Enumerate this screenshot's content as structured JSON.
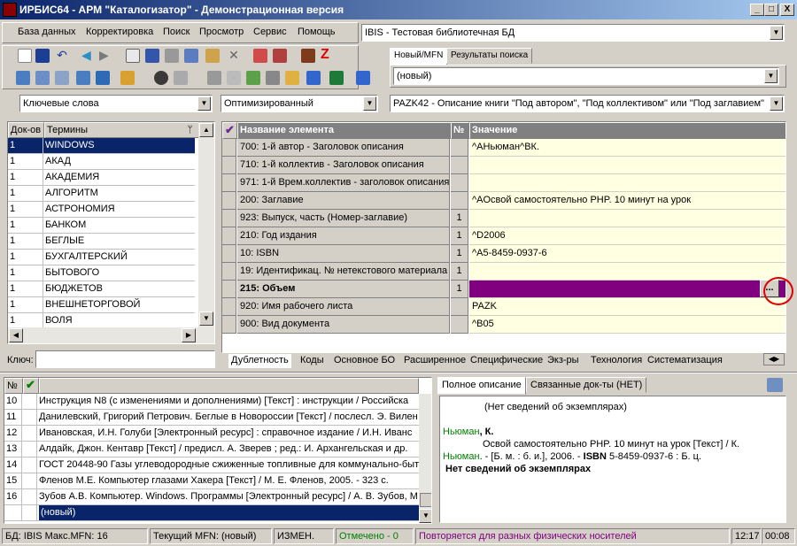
{
  "window": {
    "title": "ИРБИС64 - АРМ \"Каталогизатор\" - Демонстрационная версия",
    "min": "_",
    "max": "□",
    "close": "X"
  },
  "menu": [
    "База данных",
    "Корректировка",
    "Поиск",
    "Просмотр",
    "Сервис",
    "Помощь"
  ],
  "database_combo": "IBIS - Тестовая библиотечная БД",
  "top_tabs": [
    "Новый/MFN",
    "Результаты поиска"
  ],
  "mfn_combo": "(новый)",
  "search_combo": "Ключевые слова",
  "mode_combo": "Оптимизированный",
  "worksheet_combo": "PAZK42 - Описание книги \"Под автором\", \"Под коллективом\" или \"Под заглавием\"",
  "terms": {
    "col_docs": "Док-ов",
    "col_terms": "Термины",
    "rows": [
      {
        "n": "1",
        "t": "WINDOWS"
      },
      {
        "n": "1",
        "t": "АКАД"
      },
      {
        "n": "1",
        "t": "АКАДЕМИЯ"
      },
      {
        "n": "1",
        "t": "АЛГОРИТМ"
      },
      {
        "n": "1",
        "t": "АСТРОНОМИЯ"
      },
      {
        "n": "1",
        "t": "БАНКОМ"
      },
      {
        "n": "1",
        "t": "БЕГЛЫЕ"
      },
      {
        "n": "1",
        "t": "БУХГАЛТЕРСКИЙ"
      },
      {
        "n": "1",
        "t": "БЫТОВОГО"
      },
      {
        "n": "1",
        "t": "БЮДЖЕТОВ"
      },
      {
        "n": "1",
        "t": "ВНЕШНЕТОРГОВОЙ"
      },
      {
        "n": "1",
        "t": "ВОЛЯ"
      }
    ],
    "key_label": "Ключ:"
  },
  "record": {
    "col_name": "Название элемента",
    "col_num": "№",
    "col_value": "Значение",
    "rows": [
      {
        "name": "700: 1-й  автор - Заголовок описания",
        "num": "",
        "value": "^AНьюман^BК."
      },
      {
        "name": "710: 1-й коллектив - Заголовок описания",
        "num": "",
        "value": ""
      },
      {
        "name": "971: 1-й Врем.коллектив - заголовок описания",
        "num": "",
        "value": ""
      },
      {
        "name": "200: Заглавие",
        "num": "",
        "value": "^AОсвой самостоятельно PHP. 10 минут на урок"
      },
      {
        "name": "923: Выпуск, часть (Номер-заглавие)",
        "num": "1",
        "value": ""
      },
      {
        "name": "210: Год издания",
        "num": "1",
        "value": "^D2006"
      },
      {
        "name": "10: ISBN",
        "num": "1",
        "value": "^A5-8459-0937-6"
      },
      {
        "name": "19: Идентификац. № нетекстового материала",
        "num": "1",
        "value": ""
      },
      {
        "name": "215: Объем",
        "num": "1",
        "value": ""
      },
      {
        "name": "920: Имя рабочего листа",
        "num": "",
        "value": "PAZK"
      },
      {
        "name": "900: Вид документа",
        "num": "",
        "value": "^B05"
      }
    ],
    "ellipsis": "...",
    "bottom_tabs": [
      "Дублетность",
      "Коды",
      "Основное БО",
      "Расширенное",
      "Специфические",
      "Экз-ры",
      "Технология",
      "Систематизация"
    ]
  },
  "docs": {
    "col_num": "№",
    "rows": [
      {
        "n": "10",
        "t": "Инструкция N8   (с изменениями и дополнениями) [Текст] : инструкции / Российска"
      },
      {
        "n": "11",
        "t": "Данилевский, Григорий Петрович. Беглые в Новороссии [Текст] / послесл. Э. Вилен"
      },
      {
        "n": "12",
        "t": "Ивановская, И.Н. Голуби [Электронный ресурс] : справочное издание / И.Н. Иванс"
      },
      {
        "n": "13",
        "t": "Алдайк, Джон. Кентавр [Текст] / предисл. А. Зверев ; ред.: И. Архангельская и др."
      },
      {
        "n": "14",
        "t": "ГОСТ 20448-90 Газы углеводородные сжиженные топливные для коммунально-быт"
      },
      {
        "n": "15",
        "t": "Фленов М.Е. Компьютер глазами Хакера [Текст] / М. Е. Фленов, 2005. - 323 с."
      },
      {
        "n": "16",
        "t": "Зубов А.В. Компьютер. Windows. Программы [Электронный ресурс] / А. В. Зубов, М"
      },
      {
        "n": "",
        "t": "(новый)"
      }
    ]
  },
  "preview": {
    "tabs": [
      "Полное описание",
      "Связанные док-ты (НЕТ)"
    ],
    "line1": "(Нет сведений об экземплярах)",
    "author_green": "Ньюман",
    "author_rest": ", К.",
    "title_line": "Освой самостоятельно PHP. 10 минут на урок [Текст] / К.",
    "pub_green": "Ньюман",
    "pub_rest": ". - [Б. м. : б. и.], 2006. - ",
    "isbn_bold": "ISBN",
    "isbn_rest": " 5-8459-0937-6 : Б. ц.",
    "line_last": "Нет сведений об экземплярах"
  },
  "status": {
    "db": "БД: IBIS Макс.MFN: 16",
    "current": "Текущий MFN: (новый)",
    "changed": "ИЗМЕН.",
    "marked": "Отмечено - 0",
    "hint": "Повторяется для разных физических носителей",
    "time1": "12:17",
    "time2": "00:08"
  },
  "colors": {
    "selection": "#0a246a",
    "active_value": "#800080",
    "value_bg": "#ffffe1",
    "green": "#008000",
    "hint": "#800080"
  }
}
